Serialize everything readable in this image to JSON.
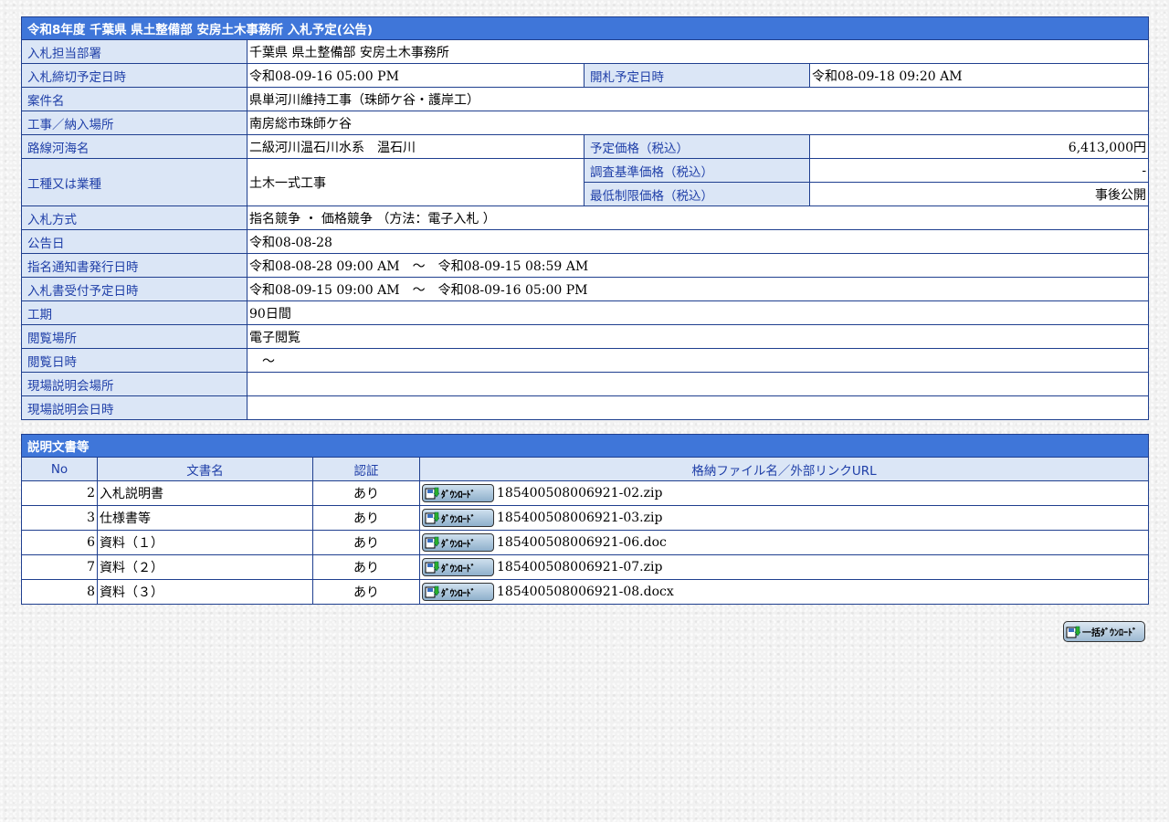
{
  "header": {
    "title": "令和8年度 千葉県 県土整備部 安房土木事務所 入札予定(公告)"
  },
  "fields": {
    "dept_label": "入札担当部署",
    "dept_value": "千葉県 県土整備部 安房土木事務所",
    "deadline_label": "入札締切予定日時",
    "deadline_value": "令和08-09-16 05:00 PM",
    "opening_label": "開札予定日時",
    "opening_value": "令和08-09-18 09:20 AM",
    "case_label": "案件名",
    "case_value": "県単河川維持工事（珠師ケ谷・護岸工）",
    "place_label": "工事／納入場所",
    "place_value": "南房総市珠師ケ谷",
    "route_label": "路線河海名",
    "route_value": "二級河川温石川水系　温石川",
    "price_label": "予定価格（税込）",
    "price_value": "6,413,000円",
    "type_label": "工種又は業種",
    "type_value": "土木一式工事",
    "survey_label": "調査基準価格（税込）",
    "survey_value": "-",
    "minimum_label": "最低制限価格（税込）",
    "minimum_value": "事後公開",
    "method_label": "入札方式",
    "method_value": "指名競争 ・ 価格競争 （方法：電子入札 ）",
    "notice_label": "公告日",
    "notice_value": "令和08-08-28",
    "issue_label": "指名通知書発行日時",
    "issue_value": "令和08-08-28 09:00 AM　～　令和08-09-15 08:59 AM",
    "receive_label": "入札書受付予定日時",
    "receive_value": "令和08-09-15 09:00 AM　～　令和08-09-16 05:00 PM",
    "period_label": "工期",
    "period_value": "90日間",
    "view_place_label": "閲覧場所",
    "view_place_value": "電子閲覧",
    "view_date_label": "閲覧日時",
    "view_date_value": "　～",
    "site_place_label": "現場説明会場所",
    "site_place_value": "",
    "site_date_label": "現場説明会日時",
    "site_date_value": ""
  },
  "docs": {
    "title": "説明文書等",
    "headers": {
      "no": "No",
      "name": "文書名",
      "auth": "認証",
      "file": "格納ファイル名／外部リンクURL"
    },
    "button_label": "ﾀﾞｳﾝﾛｰﾄﾞ",
    "rows": [
      {
        "no": "2",
        "name": "入札説明書",
        "auth": "あり",
        "file": "185400508006921-02.zip"
      },
      {
        "no": "3",
        "name": "仕様書等",
        "auth": "あり",
        "file": "185400508006921-03.zip"
      },
      {
        "no": "6",
        "name": "資料（１）",
        "auth": "あり",
        "file": "185400508006921-06.doc"
      },
      {
        "no": "7",
        "name": "資料（２）",
        "auth": "あり",
        "file": "185400508006921-07.zip"
      },
      {
        "no": "8",
        "name": "資料（３）",
        "auth": "あり",
        "file": "185400508006921-08.docx"
      }
    ],
    "bulk_label": "一括ﾀﾞｳﾝﾛｰﾄﾞ"
  },
  "colors": {
    "title_bg": "#3f76d9",
    "label_bg": "#dbe6f6",
    "label_text": "#1f3fa8",
    "border": "#1f3f8f"
  }
}
